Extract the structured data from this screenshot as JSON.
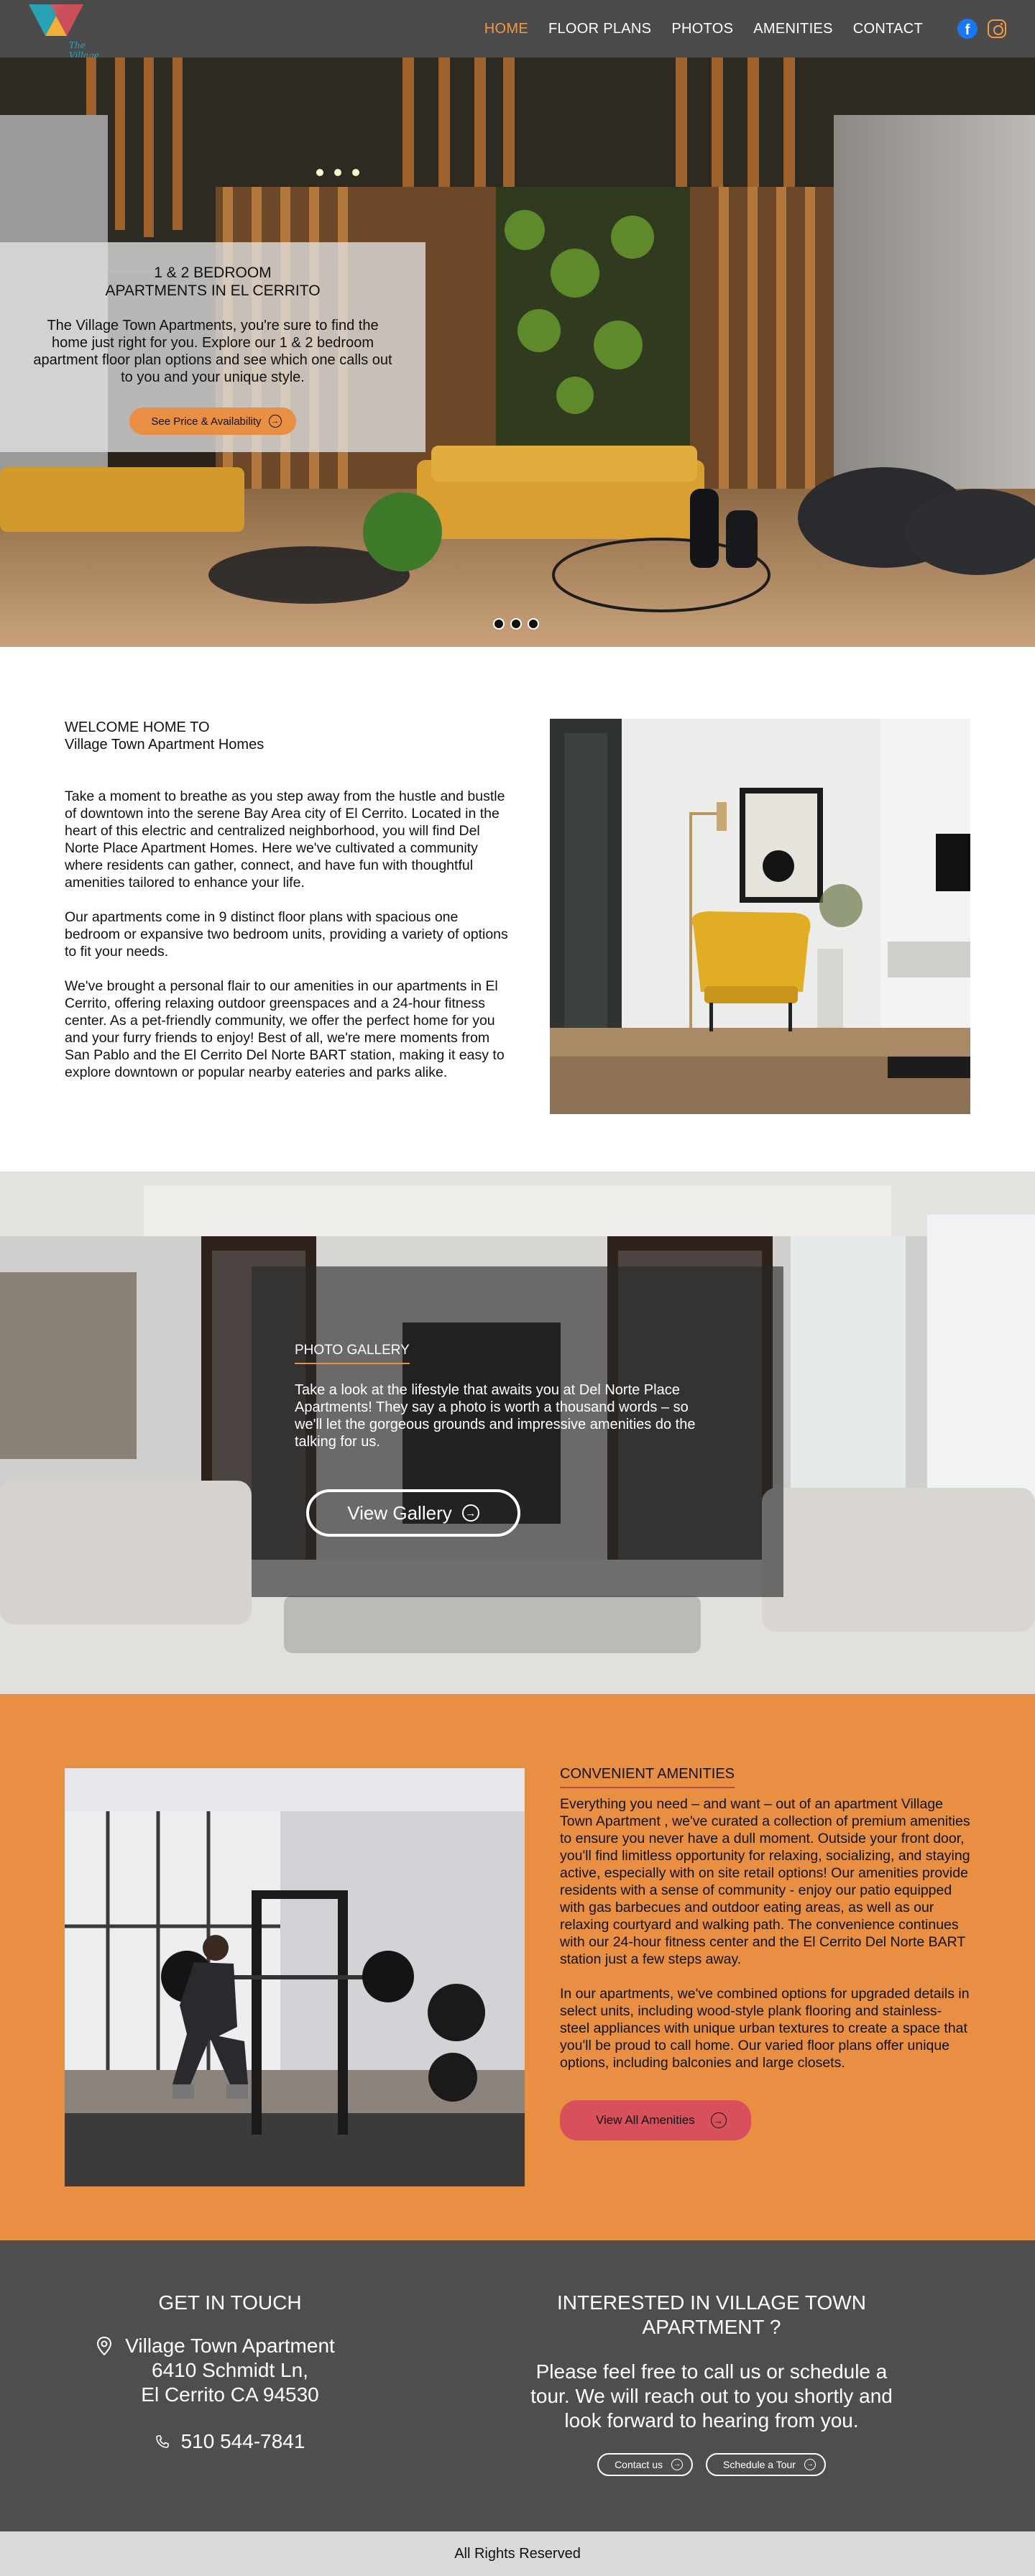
{
  "brand": {
    "logo_text": "The Village"
  },
  "nav": {
    "items": [
      {
        "label": "HOME",
        "active": true
      },
      {
        "label": "FLOOR PLANS",
        "active": false
      },
      {
        "label": "PHOTOS",
        "active": false
      },
      {
        "label": "AMENITIES",
        "active": false
      },
      {
        "label": "CONTACT",
        "active": false
      }
    ],
    "social": [
      "facebook-icon",
      "instagram-icon"
    ]
  },
  "hero": {
    "title_line1": "1 & 2 BEDROOM",
    "title_line2": "APARTMENTS IN EL CERRITO",
    "text": "The Village Town Apartments, you're sure to find the home just right for you. Explore our 1 & 2 bedroom apartment floor plan options and see which one calls out to you and your unique style.",
    "button": "See Price & Availability",
    "slides": 3
  },
  "welcome": {
    "heading_line1": "WELCOME HOME TO",
    "heading_line2": "Village Town Apartment Homes",
    "paragraphs": [
      "Take a moment to breathe as you step away from the hustle and bustle of downtown into the serene Bay Area city of El Cerrito. Located in the heart of this electric and centralized neighborhood, you will find Del Norte Place Apartment Homes. Here we've cultivated a community where residents can gather, connect, and have fun with thoughtful amenities tailored to enhance your life.",
      "Our apartments come in 9 distinct floor plans with spacious one bedroom or expansive two bedroom units, providing a variety of options to fit your needs.",
      "We've brought a personal flair to our amenities in our apartments in El Cerrito, offering relaxing outdoor greenspaces and a 24-hour fitness center. As a pet-friendly community, we offer the perfect home for you and your furry friends to enjoy! Best of all, we're mere moments from San Pablo and the El Cerrito Del Norte BART station, making it easy to explore downtown or popular nearby eateries and parks alike."
    ]
  },
  "gallery": {
    "title": "PHOTO GALLERY",
    "text": "Take a look at the lifestyle that awaits you at Del Norte Place Apartments! They say a photo is worth a thousand words – so we'll let the gorgeous grounds and impressive amenities do the talking for us.",
    "button": "View Gallery"
  },
  "amenities": {
    "title": "CONVENIENT AMENITIES",
    "paragraphs": [
      "Everything you need – and want – out of an apartment Village Town Apartment , we've curated a collection of premium amenities to ensure you never have a dull moment. Outside your front door, you'll find limitless opportunity for relaxing, socializing, and staying active, especially with on site retail options! Our amenities provide residents with a sense of community - enjoy our patio equipped with gas barbecues and outdoor eating areas, as well as our relaxing courtyard and walking path. The convenience continues with our 24-hour fitness center and the El Cerrito Del Norte BART station just a few steps away.",
      "In our apartments, we've combined options for upgraded details in select units, including wood-style plank flooring and stainless-steel appliances with unique urban textures to create a space that you'll be proud to call home. Our varied floor plans offer unique options, including balconies and large closets."
    ],
    "button": "View All Amenities"
  },
  "contact": {
    "left_heading": "GET IN TOUCH",
    "address_line1": "Village Town Apartment",
    "address_line2": "6410 Schmidt Ln,",
    "address_line3": "El Cerrito CA 94530",
    "phone": "510 544-7841",
    "right_heading": "INTERESTED IN VILLAGE TOWN APARTMENT ?",
    "right_text": "Please feel free to call us or schedule a tour. We will reach out to you shortly and look forward to hearing from you.",
    "btn_contact": "Contact us",
    "btn_tour": "Schedule a Tour"
  },
  "footer": {
    "text": "All Rights Reserved"
  },
  "colors": {
    "accent": "#e88f43",
    "nav_bg": "#4b4b4b",
    "amen_btn": "#d9505d",
    "contact_bg": "#4e4e4e"
  }
}
